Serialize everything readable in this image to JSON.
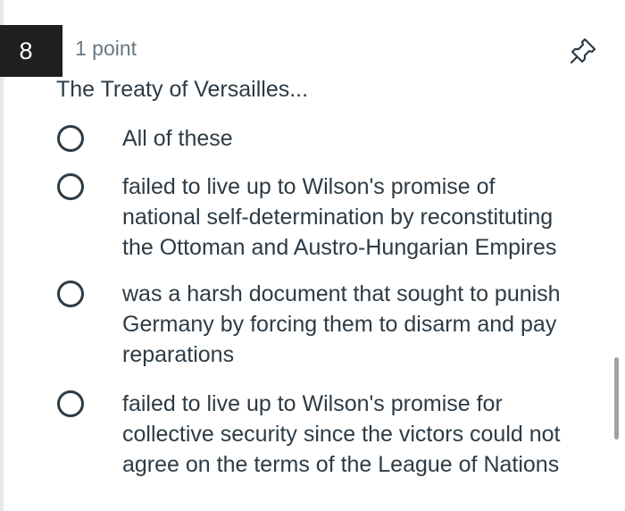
{
  "question": {
    "number": "8",
    "points": "1 point",
    "prompt": "The Treaty of Versailles...",
    "pin_icon": "pin-icon",
    "options": [
      {
        "label": "All of these"
      },
      {
        "label": "failed to live up to Wilson's promise of\nnational self-determination by reconstituting\nthe Ottoman and Austro-Hungarian Empires"
      },
      {
        "label": "was a harsh document that sought to punish\nGermany by forcing them to disarm and pay\nreparations"
      },
      {
        "label": "failed to live up to Wilson's promise for\ncollective security since the victors could not\nagree on the terms of the League of Nations"
      }
    ]
  },
  "colors": {
    "number_badge_bg": "#1f1f21",
    "text": "#2d3b45",
    "muted_text": "#6b7780"
  }
}
